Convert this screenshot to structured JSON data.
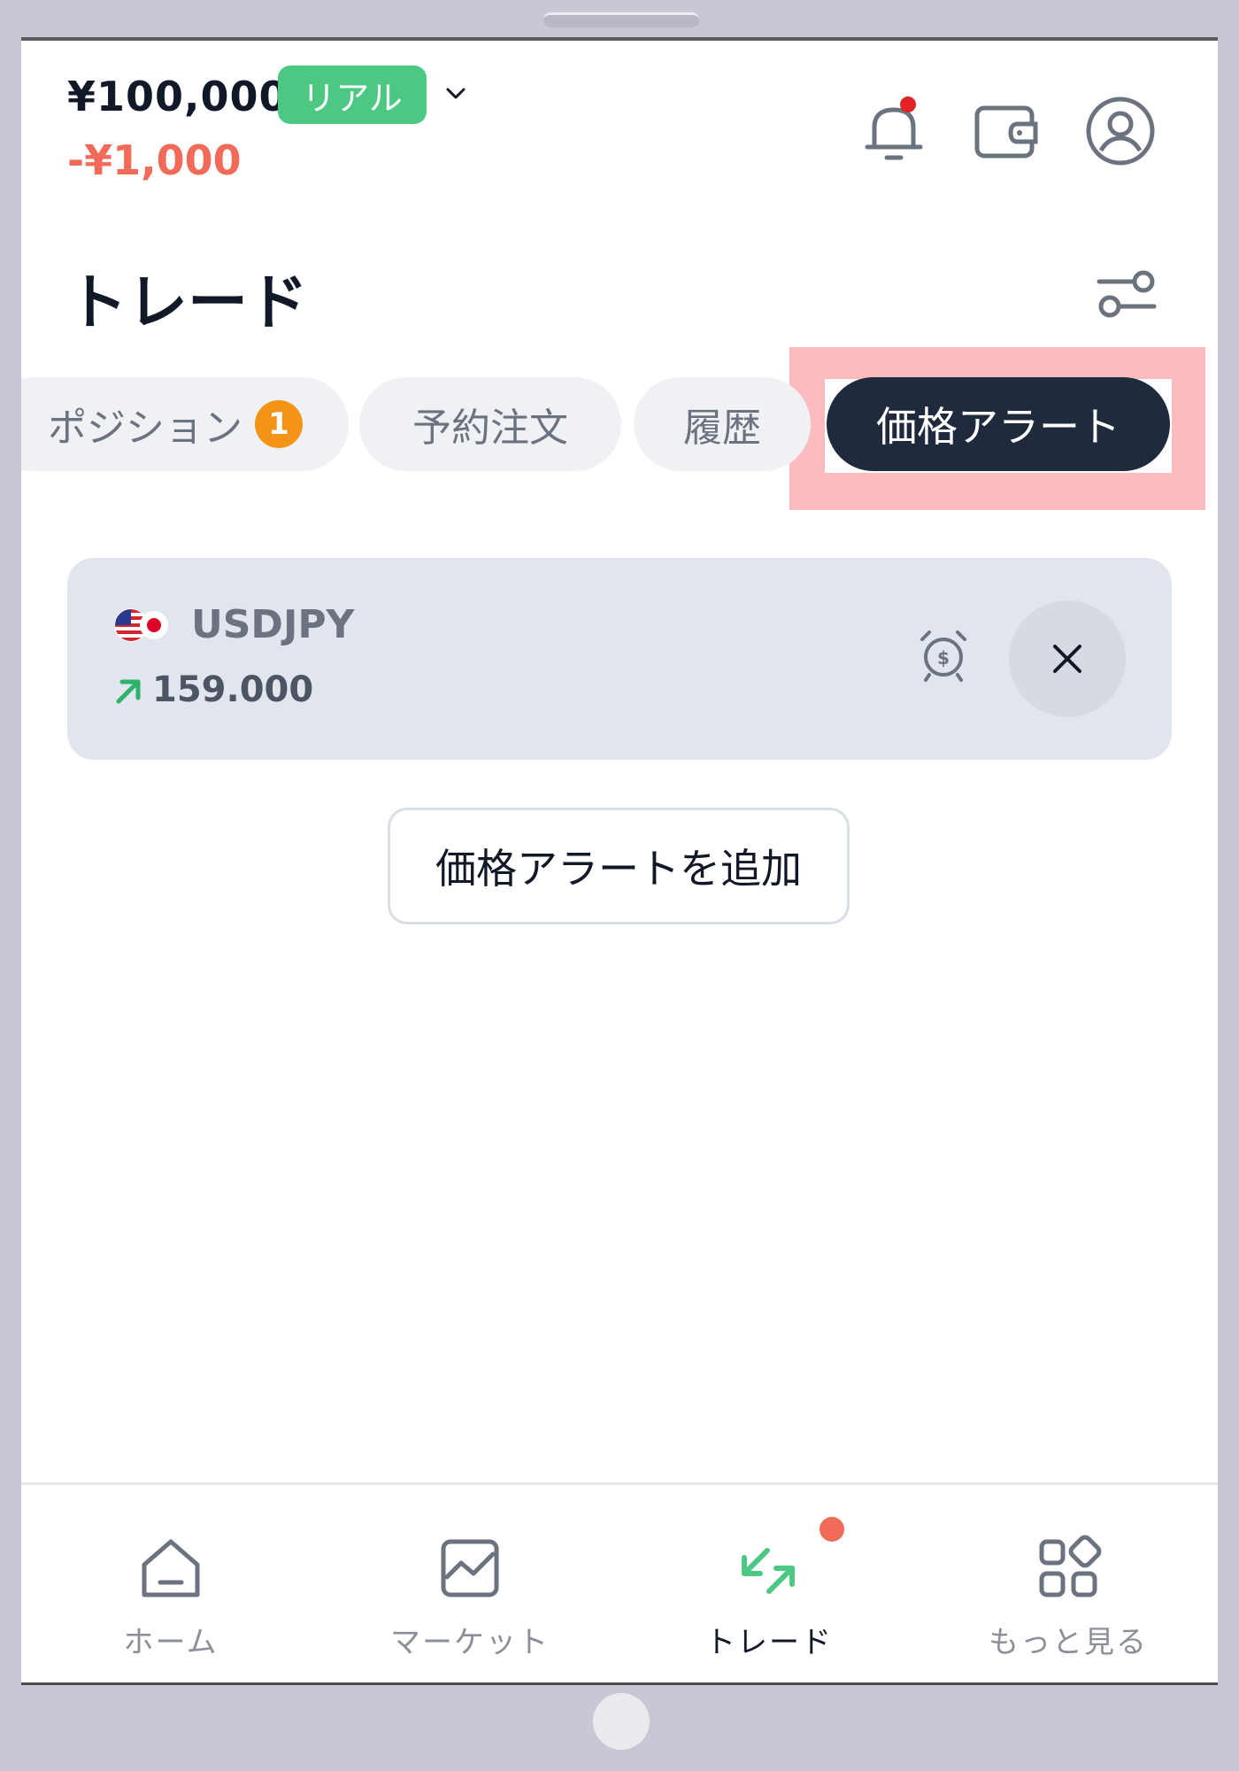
{
  "header": {
    "balance": "¥100,000",
    "account_type": "リアル",
    "pnl": "-¥1,000"
  },
  "page": {
    "title": "トレード"
  },
  "tabs": [
    {
      "label": "ポジション",
      "count": "1"
    },
    {
      "label": "予約注文"
    },
    {
      "label": "履歴"
    },
    {
      "label": "価格アラート",
      "active": true
    }
  ],
  "alert": {
    "symbol": "USDJPY",
    "price": "159.000"
  },
  "actions": {
    "add_alert": "価格アラートを追加"
  },
  "nav": [
    {
      "label": "ホーム"
    },
    {
      "label": "マーケット"
    },
    {
      "label": "トレード",
      "active": true
    },
    {
      "label": "もっと見る"
    }
  ],
  "colors": {
    "accent_green": "#4cc882",
    "loss_red": "#f16a5a",
    "badge_orange": "#f39318",
    "active_tab": "#1f2a3c",
    "highlight": "#fcbcbe"
  }
}
